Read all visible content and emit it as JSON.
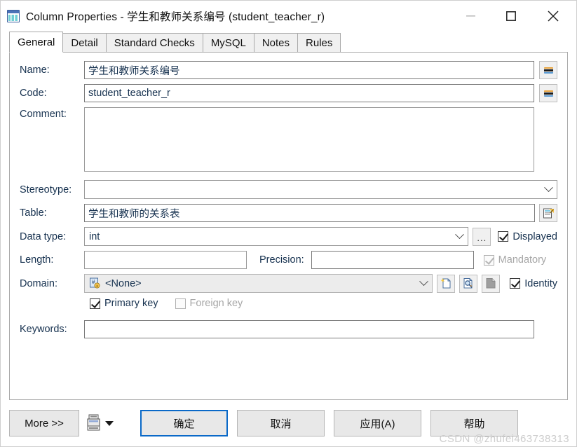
{
  "window": {
    "title": "Column Properties - 学生和教师关系编号 (student_teacher_r)",
    "icon": "table-column-icon",
    "minimize_label": "—",
    "maximize_label": "□",
    "close_label": "✕"
  },
  "tabs": [
    {
      "label": "General",
      "active": true
    },
    {
      "label": "Detail",
      "active": false
    },
    {
      "label": "Standard Checks",
      "active": false
    },
    {
      "label": "MySQL",
      "active": false
    },
    {
      "label": "Notes",
      "active": false
    },
    {
      "label": "Rules",
      "active": false
    }
  ],
  "form": {
    "name": {
      "label": "Name:",
      "value": "学生和教师关系编号",
      "button": "="
    },
    "code": {
      "label": "Code:",
      "value": "student_teacher_r",
      "button": "="
    },
    "comment": {
      "label": "Comment:",
      "value": ""
    },
    "stereotype": {
      "label": "Stereotype:",
      "value": ""
    },
    "table": {
      "label": "Table:",
      "value": "学生和教师的关系表",
      "button_icon": "table-properties-icon"
    },
    "data_type": {
      "label": "Data type:",
      "value": "int",
      "button_label": "..."
    },
    "length": {
      "label": "Length:",
      "value": ""
    },
    "precision": {
      "label": "Precision:",
      "value": ""
    },
    "domain": {
      "label": "Domain:",
      "value": "<None>",
      "icon": "domain-icon",
      "buttons": [
        {
          "name": "create-domain-button",
          "icon": "new-page-icon"
        },
        {
          "name": "domain-properties-button",
          "icon": "page-magnifier-icon"
        },
        {
          "name": "remove-domain-button",
          "icon": "page-disabled-icon"
        }
      ]
    },
    "keywords": {
      "label": "Keywords:",
      "value": ""
    },
    "checkboxes": {
      "displayed": {
        "label": "Displayed",
        "checked": true,
        "disabled": false
      },
      "mandatory": {
        "label": "Mandatory",
        "checked": true,
        "disabled": true
      },
      "identity": {
        "label": "Identity",
        "checked": true,
        "disabled": false
      },
      "primary_key": {
        "label": "Primary key",
        "checked": true,
        "disabled": false
      },
      "foreign_key": {
        "label": "Foreign key",
        "checked": false,
        "disabled": true
      }
    }
  },
  "footer": {
    "more": "More >>",
    "print_icon": "print-icon",
    "dropdown_icon": "chevron-down-icon",
    "ok": "确定",
    "cancel": "取消",
    "apply": "应用(A)",
    "help": "帮助"
  },
  "watermark": "CSDN @zhufei463738313"
}
